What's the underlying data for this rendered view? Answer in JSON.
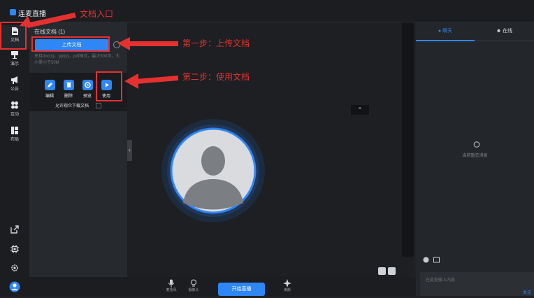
{
  "window": {
    "title": "连麦直播"
  },
  "sidebar": {
    "items": [
      {
        "label": "文档",
        "icon": "document-icon"
      },
      {
        "label": "演示",
        "icon": "presentation-icon"
      },
      {
        "label": "公告",
        "icon": "megaphone-icon"
      },
      {
        "label": "互动",
        "icon": "interaction-icon"
      },
      {
        "label": "布局",
        "icon": "layout-icon"
      }
    ],
    "bottom_icons": [
      "share-out-icon",
      "chip-icon",
      "settings-icon",
      "user-avatar-icon"
    ]
  },
  "doc_panel": {
    "title": "在线文档 (1)",
    "upload_label": "上传文档",
    "upload_hint": "支持doc(x)、ppt(x)、pdf格式，最大500页，大小需小于50M",
    "actions": [
      {
        "label": "编辑",
        "icon": "edit-icon"
      },
      {
        "label": "删除",
        "icon": "trash-icon"
      },
      {
        "label": "预览",
        "icon": "eye-icon"
      },
      {
        "label": "使用",
        "icon": "play-icon"
      }
    ],
    "allow_download": "允许观众下载文档"
  },
  "chat": {
    "tab_chat": "聊天",
    "tab_online": "在线",
    "empty": "当前暂无消息",
    "input_placeholder": "在此处输入内容",
    "send": "发送"
  },
  "bottombar": {
    "mic": "麦克风",
    "camera": "摄像头",
    "start": "开始直播",
    "beauty": "美颜"
  },
  "annotations": {
    "entry": "文档入口",
    "step1": "第一步：上传文档",
    "step2": "第二步：使用文档"
  },
  "colors": {
    "accent": "#2f86f5",
    "annotation": "#e53030",
    "background": "#1f2124"
  }
}
